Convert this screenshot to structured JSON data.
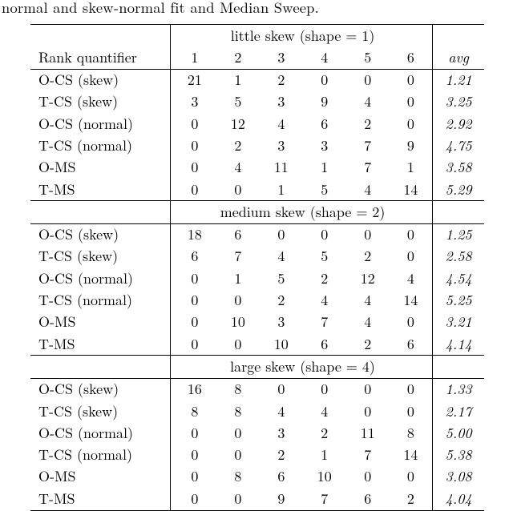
{
  "caption": "normal and skew-normal fit and Median Sweep.",
  "header": {
    "rank_quantifier": "Rank quantifier",
    "columns": [
      "1",
      "2",
      "3",
      "4",
      "5",
      "6"
    ],
    "avg": "avg"
  },
  "sections": [
    {
      "title": "little skew (shape = 1)",
      "rows": [
        {
          "label": "O-CS (skew)",
          "vals": [
            "21",
            "1",
            "2",
            "0",
            "0",
            "0"
          ],
          "avg": "1.21"
        },
        {
          "label": "T-CS (skew)",
          "vals": [
            "3",
            "5",
            "3",
            "9",
            "4",
            "0"
          ],
          "avg": "3.25"
        },
        {
          "label": "O-CS (normal)",
          "vals": [
            "0",
            "12",
            "4",
            "6",
            "2",
            "0"
          ],
          "avg": "2.92"
        },
        {
          "label": "T-CS (normal)",
          "vals": [
            "0",
            "2",
            "3",
            "3",
            "7",
            "9"
          ],
          "avg": "4.75"
        },
        {
          "label": "O-MS",
          "vals": [
            "0",
            "4",
            "11",
            "1",
            "7",
            "1"
          ],
          "avg": "3.58"
        },
        {
          "label": "T-MS",
          "vals": [
            "0",
            "0",
            "1",
            "5",
            "4",
            "14"
          ],
          "avg": "5.29"
        }
      ]
    },
    {
      "title": "medium skew (shape = 2)",
      "rows": [
        {
          "label": "O-CS (skew)",
          "vals": [
            "18",
            "6",
            "0",
            "0",
            "0",
            "0"
          ],
          "avg": "1.25"
        },
        {
          "label": "T-CS (skew)",
          "vals": [
            "6",
            "7",
            "4",
            "5",
            "2",
            "0"
          ],
          "avg": "2.58"
        },
        {
          "label": "O-CS (normal)",
          "vals": [
            "0",
            "1",
            "5",
            "2",
            "12",
            "4"
          ],
          "avg": "4.54"
        },
        {
          "label": "T-CS (normal)",
          "vals": [
            "0",
            "0",
            "2",
            "4",
            "4",
            "14"
          ],
          "avg": "5.25"
        },
        {
          "label": "O-MS",
          "vals": [
            "0",
            "10",
            "3",
            "7",
            "4",
            "0"
          ],
          "avg": "3.21"
        },
        {
          "label": "T-MS",
          "vals": [
            "0",
            "0",
            "10",
            "6",
            "2",
            "6"
          ],
          "avg": "4.14"
        }
      ]
    },
    {
      "title": "large skew (shape = 4)",
      "rows": [
        {
          "label": "O-CS (skew)",
          "vals": [
            "16",
            "8",
            "0",
            "0",
            "0",
            "0"
          ],
          "avg": "1.33"
        },
        {
          "label": "T-CS (skew)",
          "vals": [
            "8",
            "8",
            "4",
            "4",
            "0",
            "0"
          ],
          "avg": "2.17"
        },
        {
          "label": "O-CS (normal)",
          "vals": [
            "0",
            "0",
            "3",
            "2",
            "11",
            "8"
          ],
          "avg": "5.00"
        },
        {
          "label": "T-CS (normal)",
          "vals": [
            "0",
            "0",
            "2",
            "1",
            "7",
            "14"
          ],
          "avg": "5.38"
        },
        {
          "label": "O-MS",
          "vals": [
            "0",
            "8",
            "6",
            "10",
            "0",
            "0"
          ],
          "avg": "3.08"
        },
        {
          "label": "T-MS",
          "vals": [
            "0",
            "0",
            "9",
            "7",
            "6",
            "2"
          ],
          "avg": "4.04"
        }
      ]
    }
  ],
  "chart_data": {
    "type": "table",
    "title": "Rank quantifier counts across skew conditions",
    "columns": [
      "Rank quantifier",
      "1",
      "2",
      "3",
      "4",
      "5",
      "6",
      "avg"
    ],
    "sections": [
      {
        "name": "little skew (shape = 1)",
        "rows": [
          [
            "O-CS (skew)",
            21,
            1,
            2,
            0,
            0,
            0,
            1.21
          ],
          [
            "T-CS (skew)",
            3,
            5,
            3,
            9,
            4,
            0,
            3.25
          ],
          [
            "O-CS (normal)",
            0,
            12,
            4,
            6,
            2,
            0,
            2.92
          ],
          [
            "T-CS (normal)",
            0,
            2,
            3,
            3,
            7,
            9,
            4.75
          ],
          [
            "O-MS",
            0,
            4,
            11,
            1,
            7,
            1,
            3.58
          ],
          [
            "T-MS",
            0,
            0,
            1,
            5,
            4,
            14,
            5.29
          ]
        ]
      },
      {
        "name": "medium skew (shape = 2)",
        "rows": [
          [
            "O-CS (skew)",
            18,
            6,
            0,
            0,
            0,
            0,
            1.25
          ],
          [
            "T-CS (skew)",
            6,
            7,
            4,
            5,
            2,
            0,
            2.58
          ],
          [
            "O-CS (normal)",
            0,
            1,
            5,
            2,
            12,
            4,
            4.54
          ],
          [
            "T-CS (normal)",
            0,
            0,
            2,
            4,
            4,
            14,
            5.25
          ],
          [
            "O-MS",
            0,
            10,
            3,
            7,
            4,
            0,
            3.21
          ],
          [
            "T-MS",
            0,
            0,
            10,
            6,
            2,
            6,
            4.14
          ]
        ]
      },
      {
        "name": "large skew (shape = 4)",
        "rows": [
          [
            "O-CS (skew)",
            16,
            8,
            0,
            0,
            0,
            0,
            1.33
          ],
          [
            "T-CS (skew)",
            8,
            8,
            4,
            4,
            0,
            0,
            2.17
          ],
          [
            "O-CS (normal)",
            0,
            0,
            3,
            2,
            11,
            8,
            5.0
          ],
          [
            "T-CS (normal)",
            0,
            0,
            2,
            1,
            7,
            14,
            5.38
          ],
          [
            "O-MS",
            0,
            8,
            6,
            10,
            0,
            0,
            3.08
          ],
          [
            "T-MS",
            0,
            0,
            9,
            7,
            6,
            2,
            4.04
          ]
        ]
      }
    ]
  }
}
